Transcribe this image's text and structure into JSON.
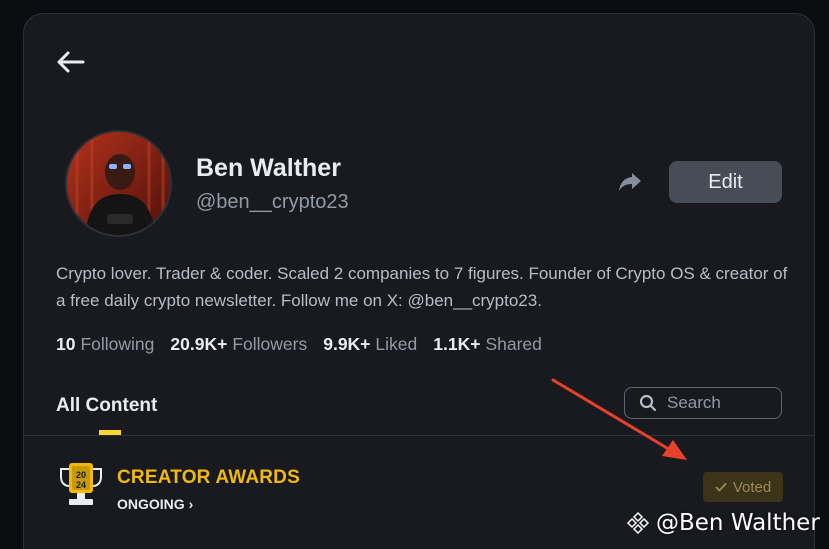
{
  "profile": {
    "name": "Ben Walther",
    "handle": "@ben__crypto23",
    "edit_label": "Edit",
    "bio": "Crypto lover. Trader & coder. Scaled 2 companies to 7 figures. Founder of Crypto OS & creator of a free daily crypto newsletter. Follow me on X: @ben__crypto23."
  },
  "stats": [
    {
      "value": "10",
      "label": "Following"
    },
    {
      "value": "20.9K+",
      "label": "Followers"
    },
    {
      "value": "9.9K+",
      "label": "Liked"
    },
    {
      "value": "1.1K+",
      "label": "Shared"
    }
  ],
  "tabs": {
    "all_content": "All Content"
  },
  "search": {
    "placeholder": "Search"
  },
  "award": {
    "title": "CREATOR AWARDS",
    "status": "ONGOING",
    "status_chevron": "›",
    "voted_label": "Voted",
    "icon_year_top": "20",
    "icon_year_bottom": "24"
  },
  "watermark": {
    "text": "@Ben Walther"
  },
  "colors": {
    "background": "#181a20",
    "accent": "#f0b90b",
    "annotation_arrow": "#e8412b"
  },
  "icons": {
    "back": "arrow-left-icon",
    "share": "share-arrow-icon",
    "search": "magnifier-icon",
    "voted": "checkmark-icon",
    "award": "trophy-icon",
    "watermark": "binance-diamond-icon"
  }
}
